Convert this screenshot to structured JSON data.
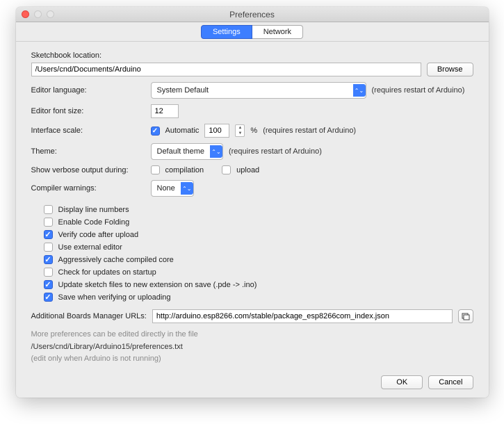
{
  "title": "Preferences",
  "tabs": {
    "settings": "Settings",
    "network": "Network"
  },
  "labels": {
    "sketchbook": "Sketchbook location:",
    "browse": "Browse",
    "language": "Editor language:",
    "fontsize": "Editor font size:",
    "scale": "Interface scale:",
    "theme": "Theme:",
    "verbose": "Show verbose output during:",
    "warnings": "Compiler warnings:",
    "automatic": "Automatic",
    "percent": "%",
    "restart": "(requires restart of Arduino)",
    "compilation": "compilation",
    "upload": "upload",
    "addurls": "Additional Boards Manager URLs:",
    "ok": "OK",
    "cancel": "Cancel"
  },
  "values": {
    "sketchbook_path": "/Users/cnd/Documents/Arduino",
    "language": "System Default",
    "fontsize": "12",
    "scale": "100",
    "theme": "Default theme",
    "warnings": "None",
    "addurls": "http://arduino.esp8266.com/stable/package_esp8266com_index.json"
  },
  "checkboxes": [
    {
      "label": "Display line numbers",
      "checked": false
    },
    {
      "label": "Enable Code Folding",
      "checked": false
    },
    {
      "label": "Verify code after upload",
      "checked": true
    },
    {
      "label": "Use external editor",
      "checked": false
    },
    {
      "label": "Aggressively cache compiled core",
      "checked": true
    },
    {
      "label": "Check for updates on startup",
      "checked": false
    },
    {
      "label": "Update sketch files to new extension on save (.pde -> .ino)",
      "checked": true
    },
    {
      "label": "Save when verifying or uploading",
      "checked": true
    }
  ],
  "footer": {
    "line1": "More preferences can be edited directly in the file",
    "path": "/Users/cnd/Library/Arduino15/preferences.txt",
    "line2": "(edit only when Arduino is not running)"
  }
}
